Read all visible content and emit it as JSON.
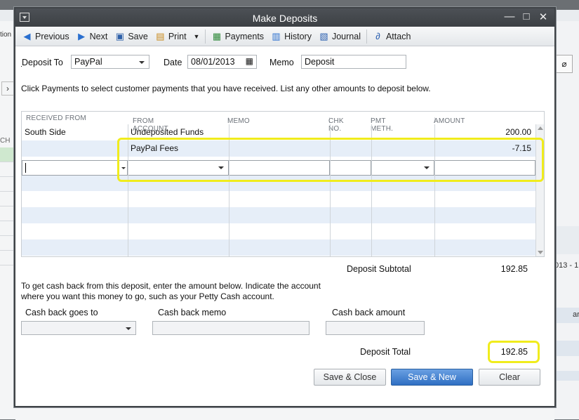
{
  "window": {
    "title": "Make Deposits"
  },
  "toolbar": {
    "previous": "Previous",
    "next": "Next",
    "save": "Save",
    "print": "Print",
    "payments": "Payments",
    "history": "History",
    "journal": "Journal",
    "attach": "Attach"
  },
  "header": {
    "deposit_to_label": "Deposit To",
    "deposit_to_value": "PayPal",
    "date_label": "Date",
    "date_value": "08/01/2013",
    "memo_label": "Memo",
    "memo_value": "Deposit"
  },
  "instructions": "Click Payments to select customer payments that you have received. List any other amounts to deposit below.",
  "table": {
    "columns": [
      "RECEIVED FROM",
      "FROM ACCOUNT",
      "MEMO",
      "CHK NO.",
      "PMT METH.",
      "AMOUNT"
    ],
    "rows": [
      {
        "received_from": "South Side",
        "from_account": "Undeposited Funds",
        "memo": "",
        "chk_no": "",
        "pmt_meth": "",
        "amount": "200.00"
      },
      {
        "received_from": "",
        "from_account": "PayPal Fees",
        "memo": "",
        "chk_no": "",
        "pmt_meth": "",
        "amount": "-7.15"
      }
    ]
  },
  "subtotal": {
    "label": "Deposit Subtotal",
    "value": "192.85"
  },
  "cashback": {
    "instructions_line1": "To get cash back from this deposit, enter the amount below.  Indicate the account",
    "instructions_line2": "where you want this money to go, such as your Petty Cash account.",
    "goes_to_label": "Cash back goes to",
    "memo_label": "Cash back memo",
    "amount_label": "Cash back amount"
  },
  "total": {
    "label": "Deposit Total",
    "value": "192.85"
  },
  "buttons": {
    "save_close": "Save & Close",
    "save_new": "Save & New",
    "clear": "Clear"
  },
  "background": {
    "left_label": "tion",
    "left_col": "CH",
    "right_text1": "013 - 1",
    "right_text2": "ar"
  },
  "colors": {
    "highlight": "#f0ec1d",
    "primary_button": "#2f6fc3",
    "alt_row": "#e6eef8"
  }
}
